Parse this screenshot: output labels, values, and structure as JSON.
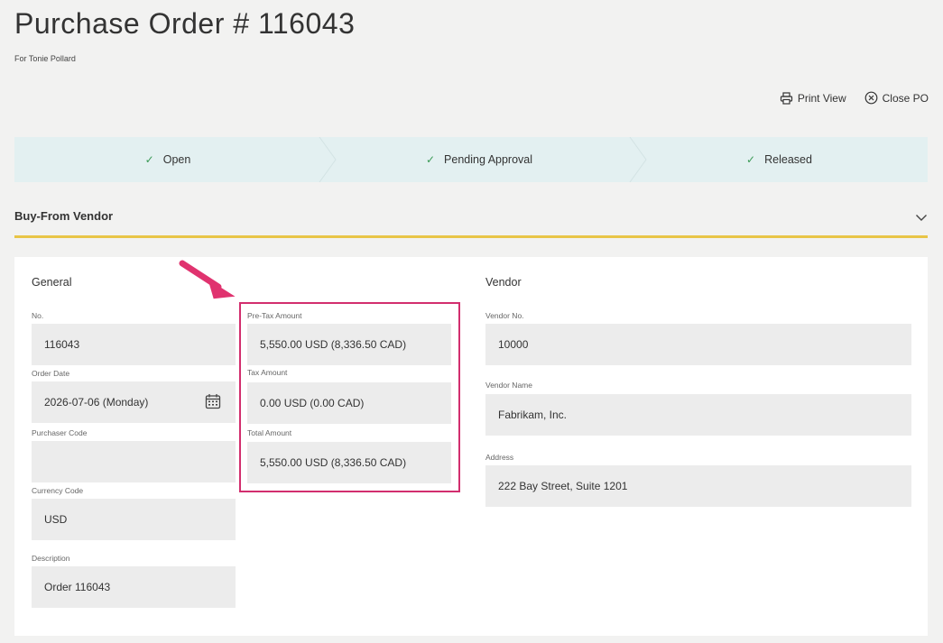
{
  "header": {
    "title": "Purchase Order  # 116043",
    "subtitle": "For Tonie Pollard"
  },
  "actions": {
    "print_label": "Print View",
    "close_label": "Close PO"
  },
  "stepper": {
    "steps": [
      {
        "label": "Open",
        "status": "completed"
      },
      {
        "label": "Pending Approval",
        "status": "completed"
      },
      {
        "label": "Released",
        "status": "completed"
      }
    ]
  },
  "section": {
    "title": "Buy-From Vendor"
  },
  "general": {
    "title": "General",
    "no_label": "No.",
    "no_value": "116043",
    "order_date_label": "Order Date",
    "order_date_value": "2026-07-06 (Monday)",
    "purchaser_code_label": "Purchaser Code",
    "purchaser_code_value": "",
    "currency_code_label": "Currency Code",
    "currency_code_value": "USD",
    "description_label": "Description",
    "description_value": "Order 116043"
  },
  "amounts": {
    "pretax_label": "Pre-Tax Amount",
    "pretax_value": "5,550.00 USD (8,336.50 CAD)",
    "tax_label": "Tax Amount",
    "tax_value": "0.00 USD (0.00 CAD)",
    "total_label": "Total Amount",
    "total_value": "5,550.00 USD (8,336.50 CAD)"
  },
  "vendor": {
    "title": "Vendor",
    "vendor_no_label": "Vendor No.",
    "vendor_no_value": "10000",
    "vendor_name_label": "Vendor Name",
    "vendor_name_value": "Fabrikam, Inc.",
    "address_label": "Address",
    "address_value": "222 Bay Street, Suite 1201"
  },
  "colors": {
    "accent_underline": "#e8c547",
    "highlight": "#d22e6e",
    "check": "#3a9a56",
    "stepper_bg": "#e3f0f1"
  }
}
